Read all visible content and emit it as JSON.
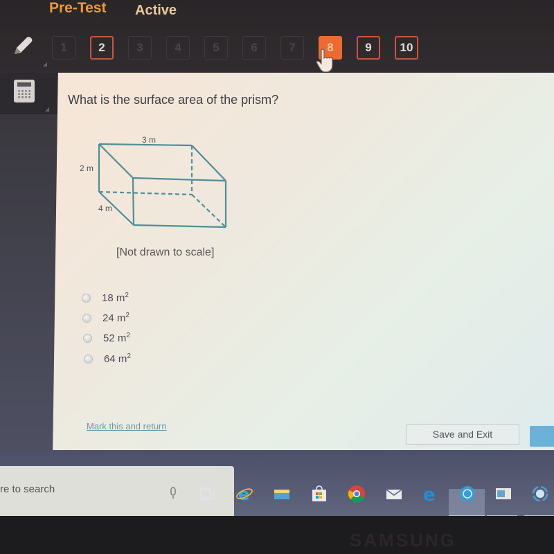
{
  "header": {
    "title": "Pre-Test",
    "status": "Active"
  },
  "question_nav": [
    {
      "label": "1",
      "state": "answered"
    },
    {
      "label": "2",
      "state": "marked"
    },
    {
      "label": "3",
      "state": "answered"
    },
    {
      "label": "4",
      "state": "answered"
    },
    {
      "label": "5",
      "state": "answered"
    },
    {
      "label": "6",
      "state": "answered"
    },
    {
      "label": "7",
      "state": "answered"
    },
    {
      "label": "8",
      "state": "current"
    },
    {
      "label": "9",
      "state": "marked"
    },
    {
      "label": "10",
      "state": "marked"
    }
  ],
  "tools": {
    "pencil": "pencil-icon",
    "calculator": "calculator-icon"
  },
  "question": {
    "text": "What is the surface area of the prism?",
    "figure": {
      "label_top": "3 m",
      "label_left": "2 m",
      "label_depth": "4 m"
    },
    "note": "[Not drawn to scale]",
    "options": [
      {
        "value": "18",
        "unit": "m",
        "exp": "2"
      },
      {
        "value": "24",
        "unit": "m",
        "exp": "2"
      },
      {
        "value": "52",
        "unit": "m",
        "exp": "2"
      },
      {
        "value": "64",
        "unit": "m",
        "exp": "2"
      }
    ]
  },
  "footer": {
    "mark_link": "Mark this and return",
    "save_exit": "Save and Exit"
  },
  "taskbar": {
    "search_text": "re to search",
    "icons": [
      "microphone-icon",
      "task-view-icon",
      "internet-explorer-icon",
      "file-explorer-icon",
      "store-icon",
      "chrome-icon",
      "mail-icon",
      "edge-icon",
      "app-icon",
      "app-window-icon",
      "sync-app-icon"
    ]
  },
  "brand": "SAMSUNG",
  "colors": {
    "accent": "#ee6a33",
    "title": "#e99a3c",
    "link": "#5f9bb0",
    "figure_line": "#4f8e97"
  }
}
